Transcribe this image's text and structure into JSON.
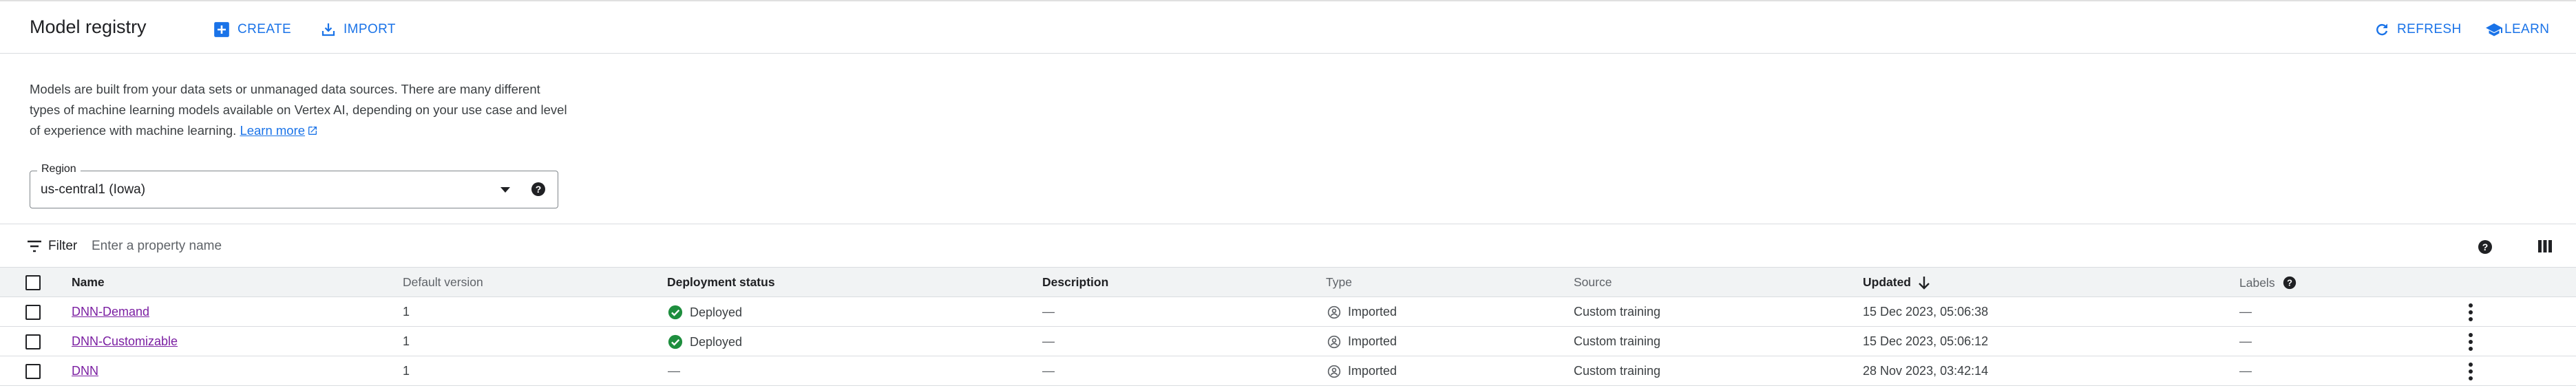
{
  "header": {
    "title": "Model registry",
    "create_label": "CREATE",
    "import_label": "IMPORT",
    "refresh_label": "REFRESH",
    "learn_label": "LEARN"
  },
  "intro": {
    "text": "Models are built from your data sets or unmanaged data sources. There are many different types of machine learning models available on Vertex AI, depending on your use case and level of experience with machine learning.",
    "link_label": "Learn more"
  },
  "region": {
    "label": "Region",
    "value": "us-central1 (Iowa)"
  },
  "filter": {
    "label": "Filter",
    "placeholder": "Enter a property name"
  },
  "table": {
    "columns": {
      "name": "Name",
      "default_version": "Default version",
      "deployment_status": "Deployment status",
      "description": "Description",
      "type": "Type",
      "source": "Source",
      "updated": "Updated",
      "labels": "Labels"
    },
    "rows": [
      {
        "name": "DNN-Demand",
        "default_version": "1",
        "deployment_status": "Deployed",
        "deployed": true,
        "description": "—",
        "type": "Imported",
        "source": "Custom training",
        "updated": "15 Dec 2023, 05:06:38",
        "labels": "—"
      },
      {
        "name": "DNN-Customizable",
        "default_version": "1",
        "deployment_status": "Deployed",
        "deployed": true,
        "description": "—",
        "type": "Imported",
        "source": "Custom training",
        "updated": "15 Dec 2023, 05:06:12",
        "labels": "—"
      },
      {
        "name": "DNN",
        "default_version": "1",
        "deployment_status": "—",
        "deployed": false,
        "description": "—",
        "type": "Imported",
        "source": "Custom training",
        "updated": "28 Nov 2023, 03:42:14",
        "labels": "—"
      }
    ]
  },
  "colors": {
    "accent": "#1a73e8",
    "deployed": "#1e8e3e",
    "link_visited": "#7b1fa2"
  },
  "icons": {
    "create": "add-box-icon",
    "import": "import-icon",
    "refresh": "refresh-icon",
    "learn": "school-icon",
    "filter": "filter-icon",
    "help": "help-icon",
    "columns": "column-display-icon",
    "deployed": "check-circle-icon",
    "imported": "imported-icon",
    "sort": "arrow-down-icon",
    "row_menu": "more-vert-icon"
  }
}
